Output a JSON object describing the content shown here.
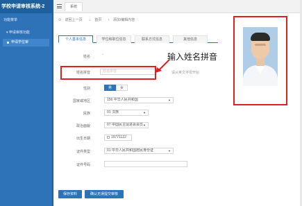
{
  "app": {
    "title": "学校申请审核系统-2"
  },
  "sidebar": {
    "items": [
      {
        "label": "功能菜单"
      },
      {
        "label": "申请审核功能"
      },
      {
        "label": "申请学位审"
      }
    ]
  },
  "topbar": {
    "tab_label": "系统"
  },
  "breadcrumb": {
    "back": "返回上一页",
    "home": "首页",
    "current": "添加/编辑内容"
  },
  "tabs": [
    {
      "label": "个人基本信息"
    },
    {
      "label": "学位和职位信息"
    },
    {
      "label": "联系方式信息"
    },
    {
      "label": "其他信息"
    }
  ],
  "form": {
    "name_label": "姓名",
    "pinyin_label": "姓名拼音",
    "pinyin_placeholder": "姓名拼音",
    "pinyin_note": "请从英文字母开始",
    "gender_label": "性别",
    "gender_male": "男",
    "gender_female": "女",
    "nationality_label": "国家或地区",
    "nationality_value": "156 中华人民共和国",
    "ethnicity_label": "民族",
    "ethnicity_value": "01 汉族",
    "political_label": "政治面貌",
    "political_value": "07 中国民主促进会会员",
    "birthdate_label": "出生日期",
    "birthdate_value": "19771122",
    "idtype_label": "证件类型",
    "idtype_value": "01 中华人民共和国居民身份证",
    "idnum_label": "证件号码"
  },
  "buttons": {
    "save": "保存资料",
    "confirm": "确认无误提交审核"
  },
  "annotation": {
    "text": "输入姓名拼音"
  },
  "colors": {
    "accent": "#2e72b8",
    "highlight": "#e02020"
  }
}
